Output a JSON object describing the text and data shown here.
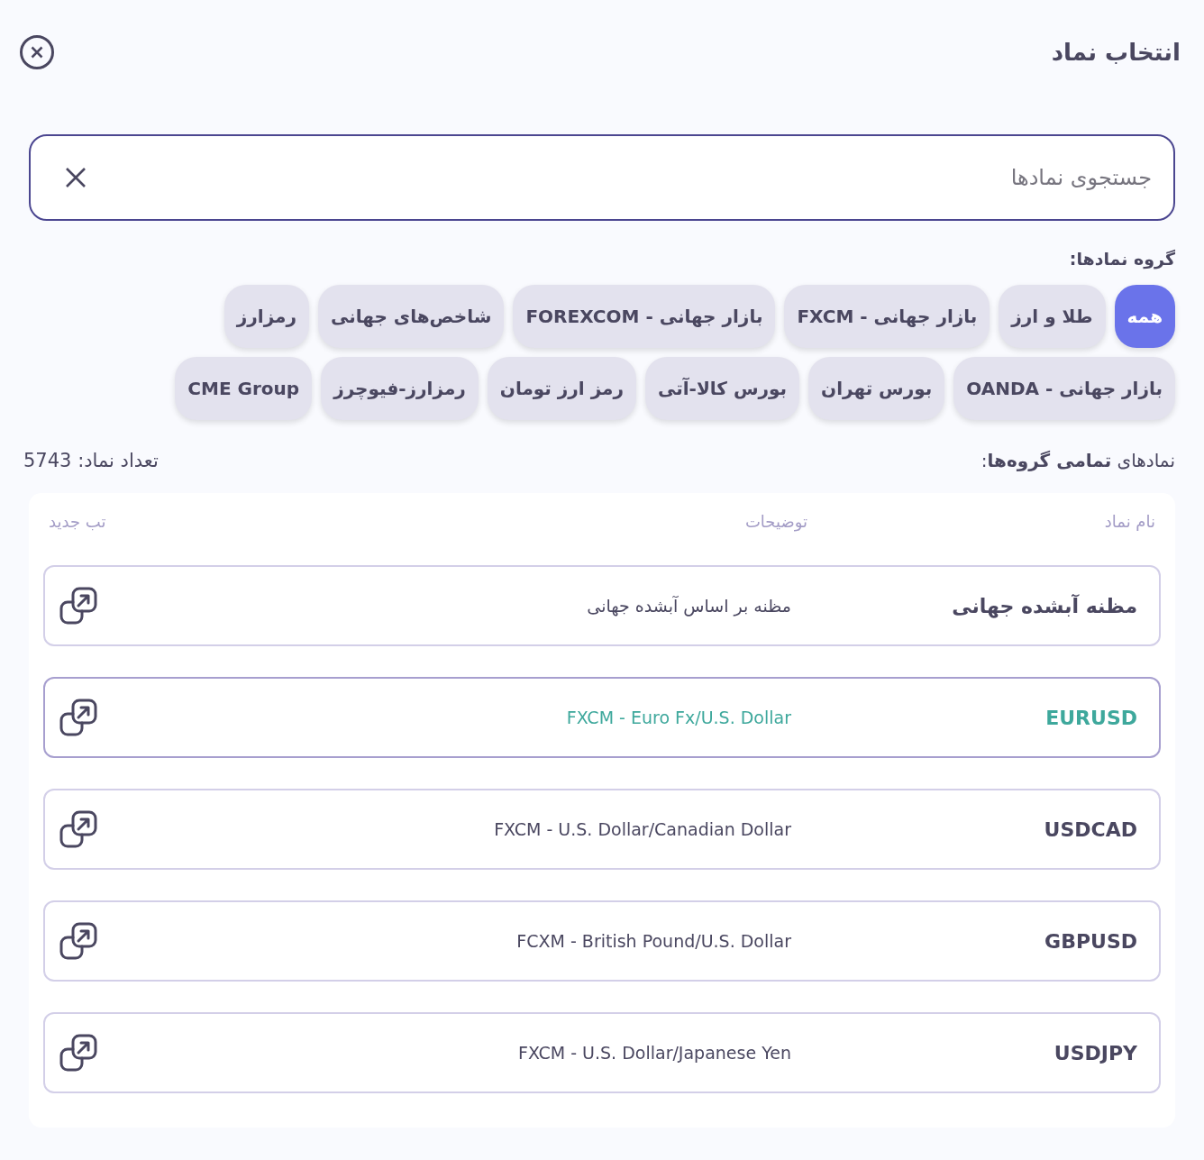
{
  "dialog": {
    "title": "انتخاب نماد"
  },
  "search": {
    "placeholder": "جستجوی نمادها"
  },
  "groups": {
    "label": "گروه نمادها:",
    "chips": [
      {
        "label": "همه",
        "selected": true
      },
      {
        "label": "طلا و ارز",
        "selected": false
      },
      {
        "label": "بازار جهانی - FXCM",
        "selected": false
      },
      {
        "label": "بازار جهانی - FOREXCOM",
        "selected": false
      },
      {
        "label": "شاخص‌های جهانی",
        "selected": false
      },
      {
        "label": "رمزارز",
        "selected": false
      },
      {
        "label": "بازار جهانی - OANDA",
        "selected": false
      },
      {
        "label": "بورس تهران",
        "selected": false
      },
      {
        "label": "بورس کالا-آتی",
        "selected": false
      },
      {
        "label": "رمز ارز تومان",
        "selected": false
      },
      {
        "label": "رمزارز-فیوچرز",
        "selected": false
      },
      {
        "label": "CME Group",
        "selected": false
      }
    ]
  },
  "summary": {
    "heading": "نمادهای **تمامی گروه‌ها**:",
    "count": "تعداد نماد: 5743"
  },
  "table": {
    "columns": [
      "نام نماد",
      "توضیحات",
      "تب جدید"
    ],
    "rows": [
      {
        "symbol": "مظنه آبشده جهانی",
        "description": "مظنه بر اساس آبشده جهانی",
        "selected": false
      },
      {
        "symbol": "EURUSD",
        "description": "FXCM - Euro Fx/U.S. Dollar",
        "selected": true
      },
      {
        "symbol": "USDCAD",
        "description": "FXCM - U.S. Dollar/Canadian Dollar",
        "selected": false
      },
      {
        "symbol": "GBPUSD",
        "description": "FCXM - British Pound/U.S. Dollar",
        "selected": false
      },
      {
        "symbol": "USDJPY",
        "description": "FXCM - U.S. Dollar/Japanese Yen",
        "selected": false
      }
    ]
  }
}
